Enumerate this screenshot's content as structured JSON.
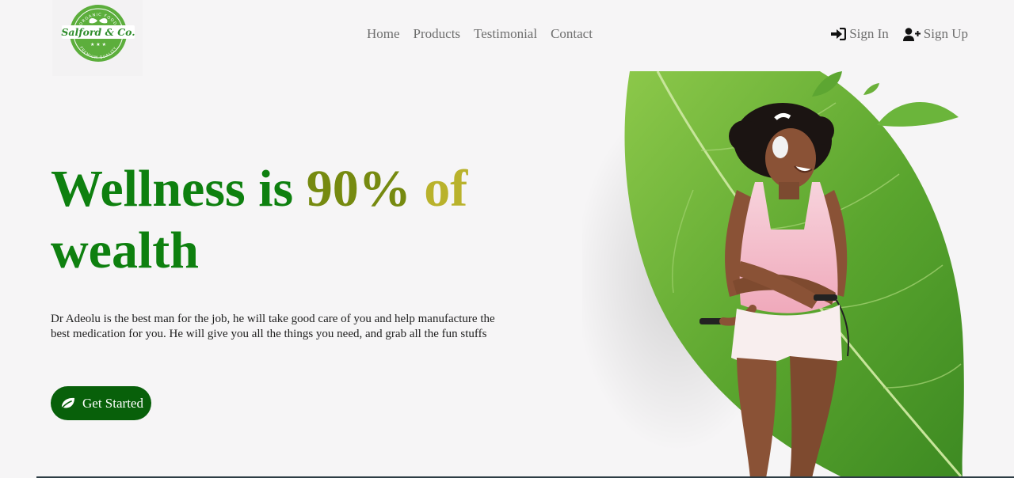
{
  "brand": {
    "name": "Salford & Co.",
    "arc_top": "ORGANIC FOOD",
    "arc_bottom": "PREMIUM QUALITY",
    "stars": "★ ★ ★"
  },
  "nav": {
    "items": [
      {
        "label": "Home"
      },
      {
        "label": "Products"
      },
      {
        "label": "Testimonial"
      },
      {
        "label": "Contact"
      }
    ]
  },
  "auth": {
    "sign_in": "Sign In",
    "sign_in_icon": "sign-in-icon",
    "sign_up": "Sign Up",
    "sign_up_icon": "user-plus-icon"
  },
  "hero": {
    "title_part1": "Wellness is",
    "title_part2": "90%",
    "title_part3": "of",
    "title_part4": "wealth",
    "description": "Dr Adeolu is the best man for the job, he will take good care of you and help manufacture the best medication for you. He will give you all the things you need, and grab all the fun stuffs",
    "cta_label": "Get Started",
    "cta_icon": "leaf-icon"
  },
  "colors": {
    "primary_green": "#0e800f",
    "olive": "#768a10",
    "gold": "#b9b22c",
    "button_green": "#08600a",
    "nav_text": "#6e6e6e",
    "background": "#f6f5f6"
  }
}
